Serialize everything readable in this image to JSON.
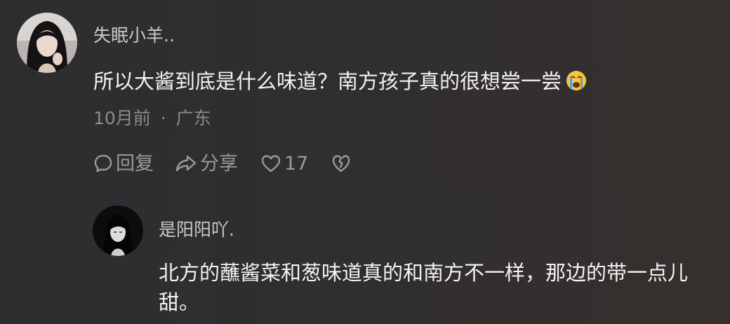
{
  "comment": {
    "username": "失眠小羊..",
    "text": "所以大酱到底是什么味道？南方孩子真的很想尝一尝",
    "emoji_icon": "loudly-crying-face-icon",
    "time": "10月前",
    "separator": "·",
    "location": "广东",
    "actions": {
      "reply_label": "回复",
      "share_label": "分享",
      "like_count": "17"
    }
  },
  "reply": {
    "username": "是阳阳吖.",
    "text": "北方的蘸酱菜和葱味道真的和南方不一样，那边的带一点儿甜。"
  },
  "colors": {
    "background": "#2f2e30",
    "primary_text": "#f3f3f3",
    "username_text": "#c9c9c9",
    "meta_text": "#8b8b8b",
    "action_text": "#9a9a9a"
  }
}
